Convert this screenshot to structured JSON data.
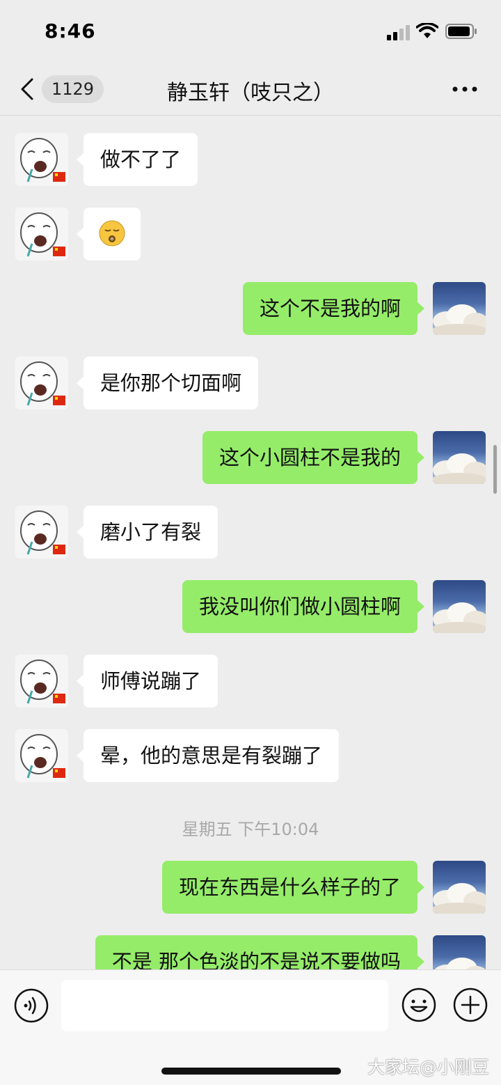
{
  "status_bar": {
    "time": "8:46"
  },
  "header": {
    "unread_count": "1129",
    "title": "静玉轩（吱只之）"
  },
  "messages": [
    {
      "side": "other",
      "text": "做不了了"
    },
    {
      "side": "other",
      "type": "sticker",
      "sticker": "sleeping-face-emoji"
    },
    {
      "side": "me",
      "text": "这个不是我的啊"
    },
    {
      "side": "other",
      "text": "是你那个切面啊"
    },
    {
      "side": "me",
      "text": "这个小圆柱不是我的"
    },
    {
      "side": "other",
      "text": "磨小了有裂"
    },
    {
      "side": "me",
      "text": "我没叫你们做小圆柱啊"
    },
    {
      "side": "other",
      "text": "师傅说蹦了"
    },
    {
      "side": "other",
      "text": "晕，他的意思是有裂蹦了"
    },
    {
      "type": "timestamp",
      "text": "星期五 下午10:04"
    },
    {
      "side": "me",
      "text": "现在东西是什么样子的了"
    },
    {
      "side": "me",
      "text": "不是 那个色淡的不是说不要做吗"
    }
  ],
  "input_bar": {
    "placeholder": ""
  },
  "watermark": "大家坛@小刚豆",
  "colors": {
    "background": "#ededed",
    "bubble_me": "#95ec69",
    "bubble_other": "#ffffff",
    "timestamp": "#a8a8a8"
  },
  "icons": [
    "signal-icon",
    "wifi-icon",
    "battery-icon",
    "back-chevron-icon",
    "more-icon",
    "voice-icon",
    "emoji-icon",
    "plus-icon"
  ]
}
